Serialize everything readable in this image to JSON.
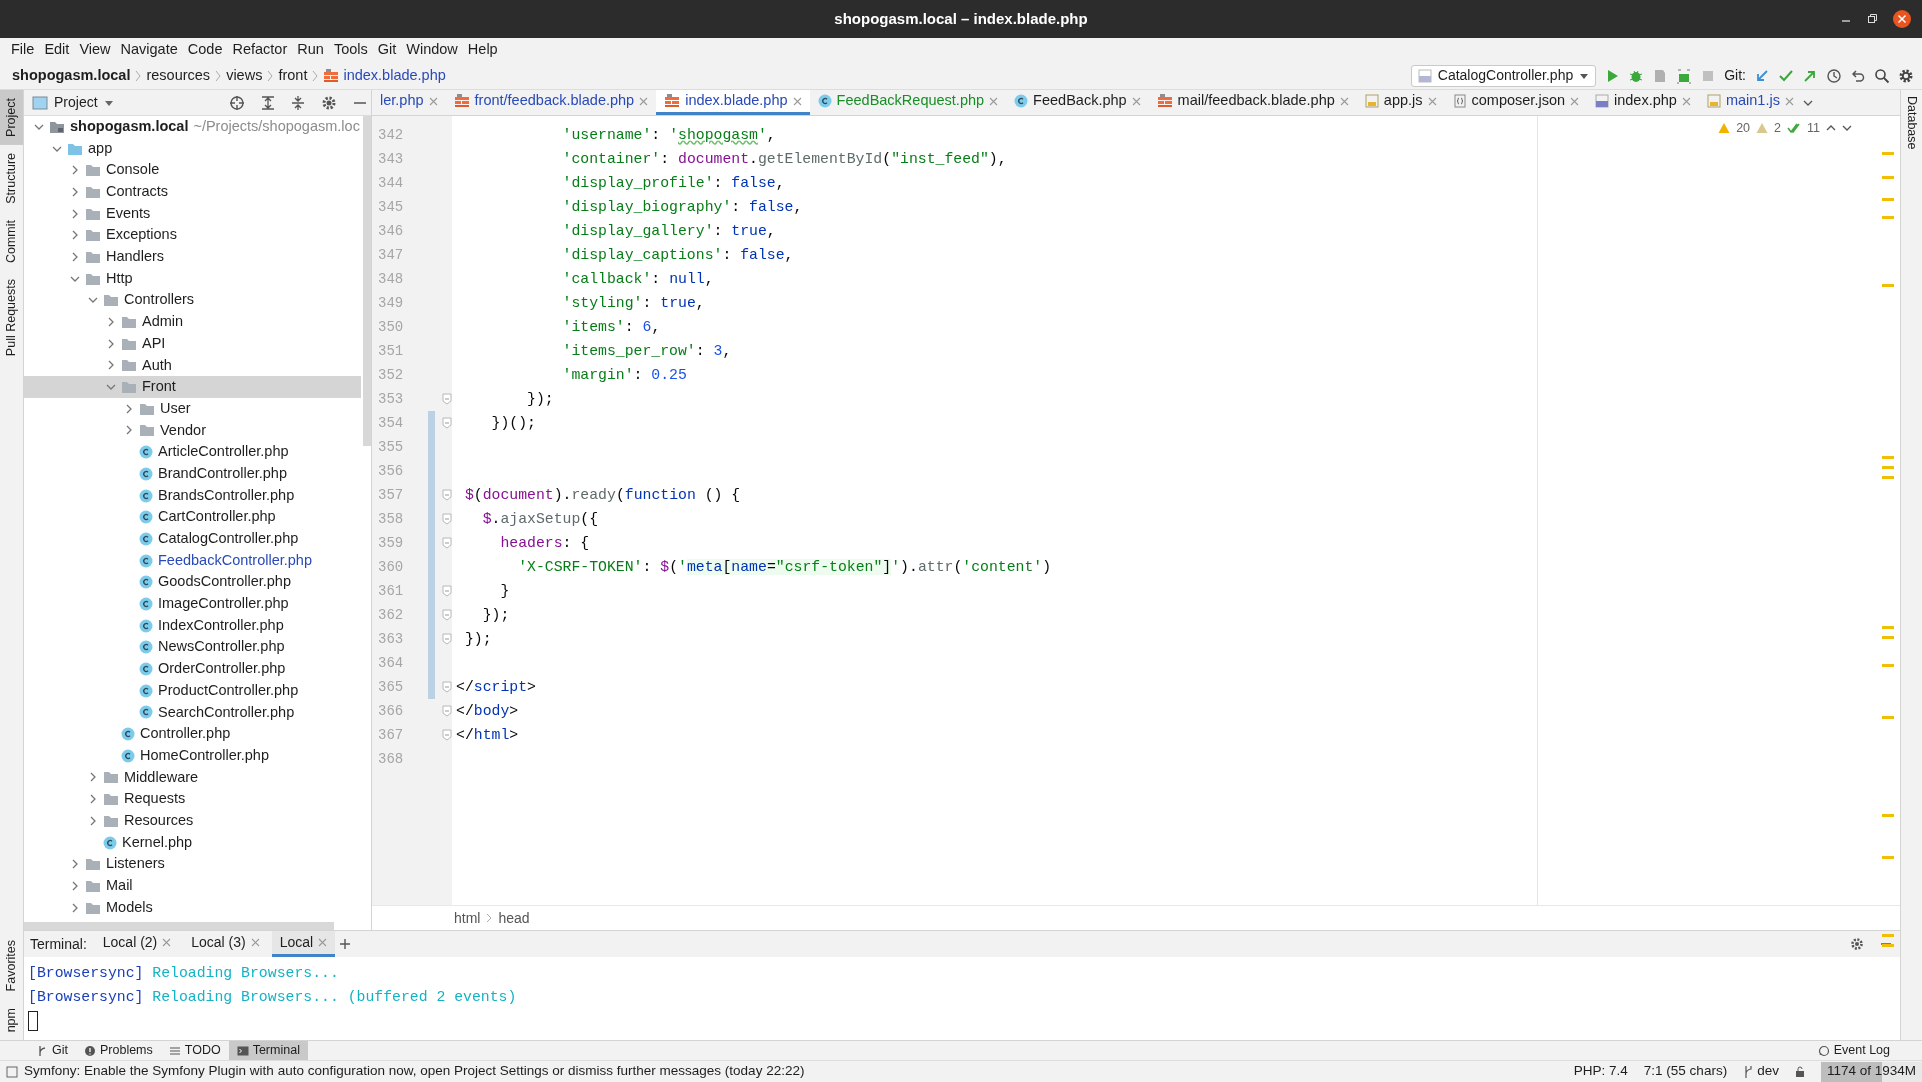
{
  "window": {
    "title": "shopogasm.local – index.blade.php"
  },
  "menu": [
    {
      "label": "File"
    },
    {
      "label": "Edit"
    },
    {
      "label": "View"
    },
    {
      "label": "Navigate"
    },
    {
      "label": "Code"
    },
    {
      "label": "Refactor"
    },
    {
      "label": "Run"
    },
    {
      "label": "Tools"
    },
    {
      "label": "Git"
    },
    {
      "label": "Window"
    },
    {
      "label": "Help"
    }
  ],
  "breadcrumb": [
    {
      "label": "shopogasm.local",
      "kind": "project"
    },
    {
      "label": "resources",
      "kind": "folder"
    },
    {
      "label": "views",
      "kind": "folder"
    },
    {
      "label": "front",
      "kind": "folder"
    },
    {
      "label": "index.blade.php",
      "kind": "blade"
    }
  ],
  "toolbar": {
    "run_config": "CatalogController.php",
    "git_label": "Git:"
  },
  "left_strip": {
    "top": [
      {
        "label": "Project",
        "selected": true
      },
      {
        "label": "Structure",
        "selected": false
      },
      {
        "label": "Commit",
        "selected": false
      },
      {
        "label": "Pull Requests",
        "selected": false
      }
    ],
    "bottom": [
      {
        "label": "Favorites",
        "selected": false
      },
      {
        "label": "npm",
        "selected": false
      }
    ]
  },
  "right_strip": [
    {
      "label": "Database"
    }
  ],
  "project_panel": {
    "title": "Project",
    "tree": [
      {
        "label": "shopogasm.local",
        "path": "~/Projects/shopogasm.loc",
        "kind": "module",
        "expanded": true,
        "selected": false,
        "modified": false,
        "children": [
          {
            "label": "app",
            "kind": "source",
            "expanded": true,
            "selected": false,
            "modified": false,
            "children": [
              {
                "label": "Console",
                "kind": "folder",
                "expanded": false,
                "selected": false,
                "modified": false
              },
              {
                "label": "Contracts",
                "kind": "folder",
                "expanded": false,
                "selected": false,
                "modified": false
              },
              {
                "label": "Events",
                "kind": "folder",
                "expanded": false,
                "selected": false,
                "modified": false
              },
              {
                "label": "Exceptions",
                "kind": "folder",
                "expanded": false,
                "selected": false,
                "modified": false
              },
              {
                "label": "Handlers",
                "kind": "folder",
                "expanded": false,
                "selected": false,
                "modified": false
              },
              {
                "label": "Http",
                "kind": "folder",
                "expanded": true,
                "selected": false,
                "modified": false,
                "children": [
                  {
                    "label": "Controllers",
                    "kind": "folder",
                    "expanded": true,
                    "selected": false,
                    "modified": false,
                    "children": [
                      {
                        "label": "Admin",
                        "kind": "folder",
                        "expanded": false,
                        "selected": false,
                        "modified": false
                      },
                      {
                        "label": "API",
                        "kind": "folder",
                        "expanded": false,
                        "selected": false,
                        "modified": false
                      },
                      {
                        "label": "Auth",
                        "kind": "folder",
                        "expanded": false,
                        "selected": false,
                        "modified": false
                      },
                      {
                        "label": "Front",
                        "kind": "folder",
                        "expanded": true,
                        "selected": true,
                        "modified": false,
                        "children": [
                          {
                            "label": "User",
                            "kind": "folder",
                            "expanded": false,
                            "selected": false,
                            "modified": false
                          },
                          {
                            "label": "Vendor",
                            "kind": "folder",
                            "expanded": false,
                            "selected": false,
                            "modified": false
                          },
                          {
                            "label": "ArticleController.php",
                            "kind": "class",
                            "selected": false,
                            "modified": false
                          },
                          {
                            "label": "BrandController.php",
                            "kind": "class",
                            "selected": false,
                            "modified": false
                          },
                          {
                            "label": "BrandsController.php",
                            "kind": "class",
                            "selected": false,
                            "modified": false
                          },
                          {
                            "label": "CartController.php",
                            "kind": "class",
                            "selected": false,
                            "modified": false
                          },
                          {
                            "label": "CatalogController.php",
                            "kind": "class",
                            "selected": false,
                            "modified": false
                          },
                          {
                            "label": "FeedbackController.php",
                            "kind": "class",
                            "selected": false,
                            "modified": true
                          },
                          {
                            "label": "GoodsController.php",
                            "kind": "class",
                            "selected": false,
                            "modified": false
                          },
                          {
                            "label": "ImageController.php",
                            "kind": "class",
                            "selected": false,
                            "modified": false
                          },
                          {
                            "label": "IndexController.php",
                            "kind": "class",
                            "selected": false,
                            "modified": false
                          },
                          {
                            "label": "NewsController.php",
                            "kind": "class",
                            "selected": false,
                            "modified": false
                          },
                          {
                            "label": "OrderController.php",
                            "kind": "class",
                            "selected": false,
                            "modified": false
                          },
                          {
                            "label": "ProductController.php",
                            "kind": "class",
                            "selected": false,
                            "modified": false
                          },
                          {
                            "label": "SearchController.php",
                            "kind": "class",
                            "selected": false,
                            "modified": false
                          }
                        ]
                      },
                      {
                        "label": "Controller.php",
                        "kind": "class",
                        "selected": false,
                        "modified": false
                      },
                      {
                        "label": "HomeController.php",
                        "kind": "class",
                        "selected": false,
                        "modified": false
                      }
                    ]
                  },
                  {
                    "label": "Middleware",
                    "kind": "folder",
                    "expanded": false,
                    "selected": false,
                    "modified": false
                  },
                  {
                    "label": "Requests",
                    "kind": "folder",
                    "expanded": false,
                    "selected": false,
                    "modified": false
                  },
                  {
                    "label": "Resources",
                    "kind": "folder",
                    "expanded": false,
                    "selected": false,
                    "modified": false
                  },
                  {
                    "label": "Kernel.php",
                    "kind": "class",
                    "selected": false,
                    "modified": false
                  }
                ]
              },
              {
                "label": "Listeners",
                "kind": "folder",
                "expanded": false,
                "selected": false,
                "modified": false
              },
              {
                "label": "Mail",
                "kind": "folder",
                "expanded": false,
                "selected": false,
                "modified": false
              },
              {
                "label": "Models",
                "kind": "folder",
                "expanded": false,
                "selected": false,
                "modified": false
              }
            ]
          }
        ]
      }
    ]
  },
  "editor_tabs": [
    {
      "label": "ler.php",
      "kind": "none",
      "color": "#2849b8",
      "selected": false
    },
    {
      "label": "front/feedback.blade.php",
      "kind": "blade",
      "color": "#2849b8",
      "selected": false
    },
    {
      "label": "index.blade.php",
      "kind": "blade",
      "color": "#2849b8",
      "selected": true
    },
    {
      "label": "FeedBackRequest.php",
      "kind": "class",
      "color": "#178f26",
      "selected": false
    },
    {
      "label": "FeedBack.php",
      "kind": "class",
      "color": "#1e1e1e",
      "selected": false
    },
    {
      "label": "mail/feedback.blade.php",
      "kind": "blade",
      "color": "#1e1e1e",
      "selected": false
    },
    {
      "label": "app.js",
      "kind": "js",
      "color": "#1e1e1e",
      "selected": false
    },
    {
      "label": "composer.json",
      "kind": "json",
      "color": "#1e1e1e",
      "selected": false
    },
    {
      "label": "index.php",
      "kind": "php",
      "color": "#1e1e1e",
      "selected": false
    },
    {
      "label": "main1.js",
      "kind": "js",
      "color": "#2849b8",
      "selected": false
    }
  ],
  "inspections": {
    "warnings": "20",
    "weak_warnings": "2",
    "ok": "11"
  },
  "code_lines": [
    {
      "number": "342",
      "fold": false,
      "changed": false,
      "tokens": [
        {
          "text": "            'username'",
          "kind": "string"
        },
        {
          "text": ": ",
          "kind": "plain"
        },
        {
          "text": "'",
          "kind": "string"
        },
        {
          "text": "shopogasm",
          "kind": "string_typo"
        },
        {
          "text": "'",
          "kind": "string"
        },
        {
          "text": ",",
          "kind": "plain"
        }
      ]
    },
    {
      "number": "343",
      "fold": false,
      "changed": false,
      "tokens": [
        {
          "text": "            'container'",
          "kind": "string"
        },
        {
          "text": ": ",
          "kind": "plain"
        },
        {
          "text": "document",
          "kind": "var"
        },
        {
          "text": ".",
          "kind": "plain"
        },
        {
          "text": "getElementById",
          "kind": "method"
        },
        {
          "text": "(",
          "kind": "plain"
        },
        {
          "text": "\"inst_feed\"",
          "kind": "string"
        },
        {
          "text": "),",
          "kind": "plain"
        }
      ]
    },
    {
      "number": "344",
      "fold": false,
      "changed": false,
      "tokens": [
        {
          "text": "            'display_profile'",
          "kind": "string"
        },
        {
          "text": ": ",
          "kind": "plain"
        },
        {
          "text": "false",
          "kind": "keyword"
        },
        {
          "text": ",",
          "kind": "plain"
        }
      ]
    },
    {
      "number": "345",
      "fold": false,
      "changed": false,
      "tokens": [
        {
          "text": "            'display_biography'",
          "kind": "string"
        },
        {
          "text": ": ",
          "kind": "plain"
        },
        {
          "text": "false",
          "kind": "keyword"
        },
        {
          "text": ",",
          "kind": "plain"
        }
      ]
    },
    {
      "number": "346",
      "fold": false,
      "changed": false,
      "tokens": [
        {
          "text": "            'display_gallery'",
          "kind": "string"
        },
        {
          "text": ": ",
          "kind": "plain"
        },
        {
          "text": "true",
          "kind": "keyword"
        },
        {
          "text": ",",
          "kind": "plain"
        }
      ]
    },
    {
      "number": "347",
      "fold": false,
      "changed": false,
      "tokens": [
        {
          "text": "            'display_captions'",
          "kind": "string"
        },
        {
          "text": ": ",
          "kind": "plain"
        },
        {
          "text": "false",
          "kind": "keyword"
        },
        {
          "text": ",",
          "kind": "plain"
        }
      ]
    },
    {
      "number": "348",
      "fold": false,
      "changed": false,
      "tokens": [
        {
          "text": "            'callback'",
          "kind": "string"
        },
        {
          "text": ": ",
          "kind": "plain"
        },
        {
          "text": "null",
          "kind": "keyword"
        },
        {
          "text": ",",
          "kind": "plain"
        }
      ]
    },
    {
      "number": "349",
      "fold": false,
      "changed": false,
      "tokens": [
        {
          "text": "            'styling'",
          "kind": "string"
        },
        {
          "text": ": ",
          "kind": "plain"
        },
        {
          "text": "true",
          "kind": "keyword"
        },
        {
          "text": ",",
          "kind": "plain"
        }
      ]
    },
    {
      "number": "350",
      "fold": false,
      "changed": false,
      "tokens": [
        {
          "text": "            'items'",
          "kind": "string"
        },
        {
          "text": ": ",
          "kind": "plain"
        },
        {
          "text": "6",
          "kind": "number"
        },
        {
          "text": ",",
          "kind": "plain"
        }
      ]
    },
    {
      "number": "351",
      "fold": false,
      "changed": false,
      "tokens": [
        {
          "text": "            'items_per_row'",
          "kind": "string"
        },
        {
          "text": ": ",
          "kind": "plain"
        },
        {
          "text": "3",
          "kind": "number"
        },
        {
          "text": ",",
          "kind": "plain"
        }
      ]
    },
    {
      "number": "352",
      "fold": false,
      "changed": false,
      "tokens": [
        {
          "text": "            'margin'",
          "kind": "string"
        },
        {
          "text": ": ",
          "kind": "plain"
        },
        {
          "text": "0.25",
          "kind": "number"
        }
      ]
    },
    {
      "number": "353",
      "fold": true,
      "changed": false,
      "tokens": [
        {
          "text": "        });",
          "kind": "plain"
        }
      ]
    },
    {
      "number": "354",
      "fold": true,
      "changed": true,
      "tokens": [
        {
          "text": "    })();",
          "kind": "plain"
        }
      ]
    },
    {
      "number": "355",
      "fold": false,
      "changed": true
    },
    {
      "number": "356",
      "fold": false,
      "changed": true
    },
    {
      "number": "357",
      "fold": true,
      "changed": true,
      "tokens": [
        {
          "text": " $",
          "kind": "var"
        },
        {
          "text": "(",
          "kind": "plain"
        },
        {
          "text": "document",
          "kind": "var"
        },
        {
          "text": ").",
          "kind": "plain"
        },
        {
          "text": "ready",
          "kind": "method"
        },
        {
          "text": "(",
          "kind": "plain"
        },
        {
          "text": "function",
          "kind": "keyword"
        },
        {
          "text": " () {",
          "kind": "plain"
        }
      ]
    },
    {
      "number": "358",
      "fold": true,
      "changed": true,
      "tokens": [
        {
          "text": "   $",
          "kind": "var"
        },
        {
          "text": ".",
          "kind": "plain"
        },
        {
          "text": "ajaxSetup",
          "kind": "method"
        },
        {
          "text": "({",
          "kind": "plain"
        }
      ]
    },
    {
      "number": "359",
      "fold": true,
      "changed": true,
      "tokens": [
        {
          "text": "     headers",
          "kind": "var"
        },
        {
          "text": ": {",
          "kind": "plain"
        }
      ]
    },
    {
      "number": "360",
      "fold": false,
      "changed": true,
      "tokens": [
        {
          "text": "       'X-CSRF-TOKEN'",
          "kind": "string"
        },
        {
          "text": ": ",
          "kind": "plain"
        },
        {
          "text": "$",
          "kind": "var"
        },
        {
          "text": "(",
          "kind": "plain"
        },
        {
          "text": "'",
          "kind": "string"
        },
        {
          "text": "meta",
          "kind": "inj_keyword"
        },
        {
          "text": "[",
          "kind": "inj"
        },
        {
          "text": "name",
          "kind": "inj_keyword"
        },
        {
          "text": "=",
          "kind": "inj"
        },
        {
          "text": "\"csrf-token\"",
          "kind": "inj_string"
        },
        {
          "text": "]",
          "kind": "inj"
        },
        {
          "text": "'",
          "kind": "string"
        },
        {
          "text": ").",
          "kind": "plain"
        },
        {
          "text": "attr",
          "kind": "method"
        },
        {
          "text": "(",
          "kind": "plain"
        },
        {
          "text": "'content'",
          "kind": "string"
        },
        {
          "text": ")",
          "kind": "plain"
        }
      ]
    },
    {
      "number": "361",
      "fold": true,
      "changed": true,
      "tokens": [
        {
          "text": "     }",
          "kind": "plain"
        }
      ]
    },
    {
      "number": "362",
      "fold": true,
      "changed": true,
      "tokens": [
        {
          "text": "   });",
          "kind": "plain"
        }
      ]
    },
    {
      "number": "363",
      "fold": true,
      "changed": true,
      "tokens": [
        {
          "text": " });",
          "kind": "plain"
        }
      ]
    },
    {
      "number": "364",
      "fold": false,
      "changed": true
    },
    {
      "number": "365",
      "fold": true,
      "changed": true,
      "tokens": [
        {
          "text": "</",
          "kind": "plain"
        },
        {
          "text": "script",
          "kind": "tag"
        },
        {
          "text": ">",
          "kind": "plain"
        }
      ]
    },
    {
      "number": "366",
      "fold": true,
      "changed": false,
      "tokens": [
        {
          "text": "</",
          "kind": "plain"
        },
        {
          "text": "body",
          "kind": "tag"
        },
        {
          "text": ">",
          "kind": "plain"
        }
      ]
    },
    {
      "number": "367",
      "fold": true,
      "changed": false,
      "tokens": [
        {
          "text": "</",
          "kind": "plain"
        },
        {
          "text": "html",
          "kind": "tag"
        },
        {
          "text": ">",
          "kind": "plain"
        }
      ]
    },
    {
      "number": "368",
      "fold": false,
      "changed": false
    }
  ],
  "code_breadcrumb": [
    {
      "label": "html"
    },
    {
      "label": "head"
    }
  ],
  "terminal": {
    "label": "Terminal:",
    "tabs": [
      {
        "label": "Local (2)",
        "selected": false
      },
      {
        "label": "Local (3)",
        "selected": false
      },
      {
        "label": "Local",
        "selected": true
      }
    ],
    "lines": [
      [
        {
          "text": "[Browsersync]",
          "kind": "tag"
        },
        {
          "text": " Reloading Browsers...",
          "kind": "info"
        }
      ],
      [
        {
          "text": "[Browsersync]",
          "kind": "tag"
        },
        {
          "text": " Reloading Browsers... (buffered 2 events)",
          "kind": "info"
        }
      ]
    ]
  },
  "tool_tabs": [
    {
      "label": "Git",
      "kind": "git",
      "selected": false
    },
    {
      "label": "Problems",
      "kind": "problems",
      "selected": false
    },
    {
      "label": "TODO",
      "kind": "todo",
      "selected": false
    },
    {
      "label": "Terminal",
      "kind": "terminal",
      "selected": true
    }
  ],
  "event_log": "Event Log",
  "status_bar": {
    "message": "Symfony: Enable the Symfony Plugin with auto configuration now, open Project Settings or dismiss further messages (today 22:22)",
    "php": "PHP: 7.4",
    "position": "7:1 (55 chars)",
    "branch": "dev",
    "memory": "1174 of 1934M",
    "memory_level": {
      "level": 0.607
    }
  }
}
